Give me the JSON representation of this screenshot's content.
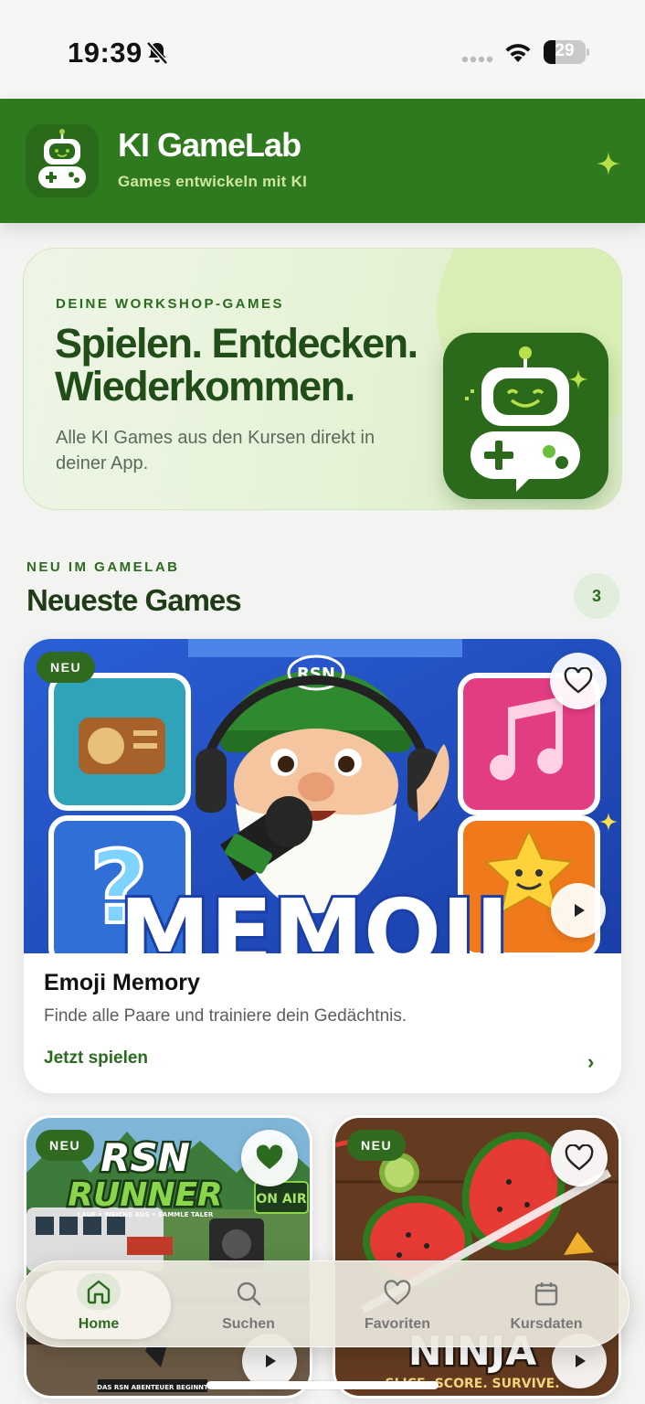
{
  "status_bar": {
    "time": "19:39",
    "battery": "29",
    "battery_level": 0.29
  },
  "app_header": {
    "title": "KI GameLab",
    "subtitle": "Games entwickeln mit KI"
  },
  "hero": {
    "eyebrow": "DEINE WORKSHOP-GAMES",
    "headline": "Spielen. Entdecken. Wiederkommen.",
    "description": "Alle KI Games aus den Kursen direkt in deiner App."
  },
  "section": {
    "eyebrow": "NEU IM GAMELAB",
    "title": "Neueste Games",
    "count": "3"
  },
  "featured_game": {
    "badge": "NEU",
    "art_text": "MEMOJI",
    "art_brand": "RSN",
    "name": "Emoji Memory",
    "description": "Finde alle Paare und trainiere dein Gedächtnis.",
    "cta": "Jetzt spielen",
    "favorited": false
  },
  "games": [
    {
      "badge": "NEU",
      "art_title": "RSN RUNNER",
      "art_tagline": "LAUF • WEICHE AUS • SAMMLE TALER",
      "art_sign": "ON AIR",
      "art_footer": "DAS RSN ABENTEUER BEGINNT",
      "favorited": true
    },
    {
      "badge": "NEU",
      "art_title": "NINJA",
      "art_tagline": "SLICE. SCORE. SURVIVE.",
      "favorited": false
    }
  ],
  "tab_bar": {
    "active": "home",
    "tabs": [
      {
        "id": "home",
        "label": "Home",
        "icon": "home-icon"
      },
      {
        "id": "search",
        "label": "Suchen",
        "icon": "search-icon"
      },
      {
        "id": "favorites",
        "label": "Favoriten",
        "icon": "heart-icon"
      },
      {
        "id": "dates",
        "label": "Kursdaten",
        "icon": "calendar-icon"
      }
    ]
  },
  "colors": {
    "brand_green": "#2f7a1f",
    "dark_green": "#2b6b1f",
    "accent_light": "#cfe6a1"
  }
}
